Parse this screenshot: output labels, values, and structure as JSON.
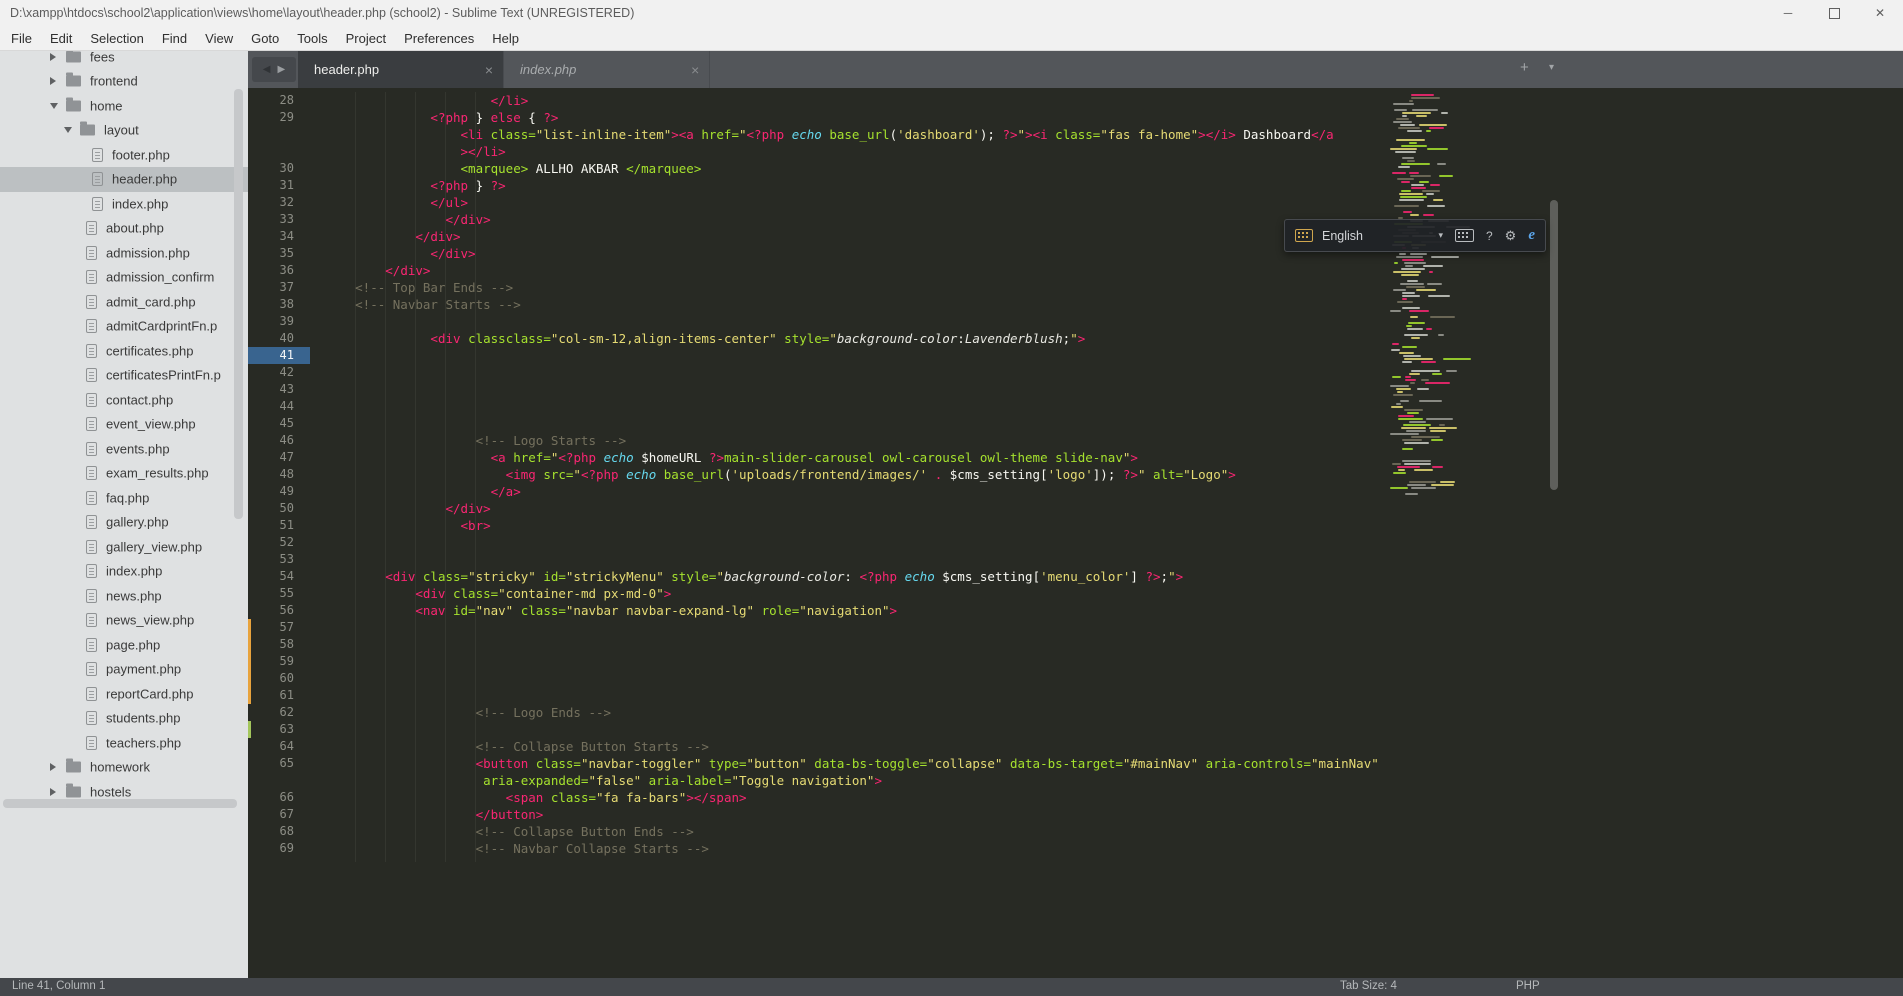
{
  "window": {
    "title": "D:\\xampp\\htdocs\\school2\\application\\views\\home\\layout\\header.php (school2) - Sublime Text (UNREGISTERED)",
    "controls": {
      "minimize": "─",
      "close": "✕"
    }
  },
  "menu": {
    "items": [
      "File",
      "Edit",
      "Selection",
      "Find",
      "View",
      "Goto",
      "Tools",
      "Project",
      "Preferences",
      "Help"
    ]
  },
  "sidebar": {
    "items": [
      {
        "label": "fees",
        "kind": "folder",
        "depth": "1",
        "arrow": "right"
      },
      {
        "label": "frontend",
        "kind": "folder",
        "depth": "1",
        "arrow": "right"
      },
      {
        "label": "home",
        "kind": "folder",
        "depth": "1",
        "arrow": "down"
      },
      {
        "label": "layout",
        "kind": "folder",
        "depth": "2",
        "arrow": "down"
      },
      {
        "label": "footer.php",
        "kind": "file",
        "depth": "3"
      },
      {
        "label": "header.php",
        "kind": "file",
        "depth": "3",
        "selected": true
      },
      {
        "label": "index.php",
        "kind": "file",
        "depth": "3"
      },
      {
        "label": "about.php",
        "kind": "file",
        "depth": "2f"
      },
      {
        "label": "admission.php",
        "kind": "file",
        "depth": "2f"
      },
      {
        "label": "admission_confirm",
        "kind": "file",
        "depth": "2f"
      },
      {
        "label": "admit_card.php",
        "kind": "file",
        "depth": "2f"
      },
      {
        "label": "admitCardprintFn.p",
        "kind": "file",
        "depth": "2f"
      },
      {
        "label": "certificates.php",
        "kind": "file",
        "depth": "2f"
      },
      {
        "label": "certificatesPrintFn.p",
        "kind": "file",
        "depth": "2f"
      },
      {
        "label": "contact.php",
        "kind": "file",
        "depth": "2f"
      },
      {
        "label": "event_view.php",
        "kind": "file",
        "depth": "2f"
      },
      {
        "label": "events.php",
        "kind": "file",
        "depth": "2f"
      },
      {
        "label": "exam_results.php",
        "kind": "file",
        "depth": "2f"
      },
      {
        "label": "faq.php",
        "kind": "file",
        "depth": "2f"
      },
      {
        "label": "gallery.php",
        "kind": "file",
        "depth": "2f"
      },
      {
        "label": "gallery_view.php",
        "kind": "file",
        "depth": "2f"
      },
      {
        "label": "index.php",
        "kind": "file",
        "depth": "2f"
      },
      {
        "label": "news.php",
        "kind": "file",
        "depth": "2f"
      },
      {
        "label": "news_view.php",
        "kind": "file",
        "depth": "2f"
      },
      {
        "label": "page.php",
        "kind": "file",
        "depth": "2f"
      },
      {
        "label": "payment.php",
        "kind": "file",
        "depth": "2f"
      },
      {
        "label": "reportCard.php",
        "kind": "file",
        "depth": "2f"
      },
      {
        "label": "students.php",
        "kind": "file",
        "depth": "2f"
      },
      {
        "label": "teachers.php",
        "kind": "file",
        "depth": "2f"
      },
      {
        "label": "homework",
        "kind": "folder",
        "depth": "1",
        "arrow": "right"
      },
      {
        "label": "hostels",
        "kind": "folder",
        "depth": "1",
        "arrow": "right"
      }
    ]
  },
  "tabs": {
    "list": [
      {
        "label": "header.php",
        "active": true
      },
      {
        "label": "index.php",
        "active": false
      }
    ],
    "close_glyph": "×",
    "new_tab_glyph": "+",
    "overflow_glyph": "▾",
    "back_glyph": "◀",
    "forward_glyph": "▶"
  },
  "editor": {
    "rows": [
      {
        "n": "28",
        "s": [
          [
            "w",
            "                        "
          ],
          [
            "r",
            "</li>"
          ]
        ]
      },
      {
        "n": "29",
        "s": [
          [
            "w",
            "                "
          ],
          [
            "r",
            "<?php"
          ],
          [
            "w",
            " } "
          ],
          [
            "r",
            "else"
          ],
          [
            "w",
            " { "
          ],
          [
            "r",
            "?>"
          ]
        ]
      },
      {
        "n": "",
        "s": [
          [
            "w",
            "                    "
          ],
          [
            "r",
            "<li"
          ],
          [
            "w",
            " "
          ],
          [
            "g",
            "class="
          ],
          [
            "y",
            "\"list-inline-item\""
          ],
          [
            "r",
            "><a"
          ],
          [
            "w",
            " "
          ],
          [
            "g",
            "href="
          ],
          [
            "y",
            "\""
          ],
          [
            "r",
            "<?php"
          ],
          [
            "w",
            " "
          ],
          [
            "b",
            "echo"
          ],
          [
            "w",
            " "
          ],
          [
            "g",
            "base_url"
          ],
          [
            "w",
            "("
          ],
          [
            "y",
            "'dashboard'"
          ],
          [
            "w",
            "); "
          ],
          [
            "r",
            "?>"
          ],
          [
            "y",
            "\""
          ],
          [
            "r",
            "><i"
          ],
          [
            "w",
            " "
          ],
          [
            "g",
            "class="
          ],
          [
            "y",
            "\"fas fa-home\""
          ],
          [
            "r",
            "></i>"
          ],
          [
            "w",
            " Dashboard"
          ],
          [
            "r",
            "</a"
          ]
        ]
      },
      {
        "n": "",
        "s": [
          [
            "w",
            "                    "
          ],
          [
            "r",
            "></li>"
          ]
        ]
      },
      {
        "n": "30",
        "s": [
          [
            "w",
            "                    "
          ],
          [
            "g",
            "<marquee>"
          ],
          [
            "w",
            " ALLHO AKBAR "
          ],
          [
            "g",
            "</marquee>"
          ]
        ]
      },
      {
        "n": "31",
        "s": [
          [
            "w",
            "                "
          ],
          [
            "r",
            "<?php"
          ],
          [
            "w",
            " } "
          ],
          [
            "r",
            "?>"
          ]
        ]
      },
      {
        "n": "32",
        "s": [
          [
            "w",
            "                "
          ],
          [
            "r",
            "</ul>"
          ]
        ]
      },
      {
        "n": "33",
        "s": [
          [
            "w",
            "                  "
          ],
          [
            "r",
            "</div>"
          ]
        ]
      },
      {
        "n": "34",
        "s": [
          [
            "w",
            "              "
          ],
          [
            "r",
            "</div>"
          ]
        ]
      },
      {
        "n": "35",
        "s": [
          [
            "w",
            "                "
          ],
          [
            "r",
            "</div>"
          ]
        ]
      },
      {
        "n": "36",
        "s": [
          [
            "w",
            "          "
          ],
          [
            "r",
            "</div>"
          ]
        ]
      },
      {
        "n": "37",
        "s": [
          [
            "w",
            "      "
          ],
          [
            "c",
            "<!-- Top Bar Ends -->"
          ]
        ]
      },
      {
        "n": "38",
        "s": [
          [
            "w",
            "      "
          ],
          [
            "c",
            "<!-- Navbar Starts -->"
          ]
        ]
      },
      {
        "n": "39",
        "s": []
      },
      {
        "n": "40",
        "s": [
          [
            "w",
            "                "
          ],
          [
            "r",
            "<div"
          ],
          [
            "w",
            " "
          ],
          [
            "g",
            "classclass="
          ],
          [
            "y",
            "\"col-sm-12,align-items-center\""
          ],
          [
            "w",
            " "
          ],
          [
            "g",
            "style="
          ],
          [
            "y",
            "\""
          ],
          [
            "ci",
            "background-color"
          ],
          [
            "w",
            ":"
          ],
          [
            "ci",
            "Lavenderblush"
          ],
          [
            "w",
            ";"
          ],
          [
            "y",
            "\""
          ],
          [
            "r",
            ">"
          ]
        ]
      },
      {
        "n": "41",
        "hl": true,
        "s": []
      },
      {
        "n": "42",
        "s": []
      },
      {
        "n": "43",
        "s": []
      },
      {
        "n": "44",
        "s": []
      },
      {
        "n": "45",
        "s": []
      },
      {
        "n": "46",
        "s": [
          [
            "w",
            "                      "
          ],
          [
            "c",
            "<!-- Logo Starts -->"
          ]
        ]
      },
      {
        "n": "47",
        "s": [
          [
            "w",
            "                        "
          ],
          [
            "r",
            "<a"
          ],
          [
            "w",
            " "
          ],
          [
            "g",
            "href="
          ],
          [
            "y",
            "\""
          ],
          [
            "r",
            "<?php"
          ],
          [
            "w",
            " "
          ],
          [
            "b",
            "echo"
          ],
          [
            "w",
            " $homeURL "
          ],
          [
            "r",
            "?>"
          ],
          [
            "g",
            "main-slider-carousel owl-carousel owl-theme slide-nav"
          ],
          [
            "y",
            "\""
          ],
          [
            "r",
            ">"
          ]
        ]
      },
      {
        "n": "48",
        "s": [
          [
            "w",
            "                          "
          ],
          [
            "r",
            "<img"
          ],
          [
            "w",
            " "
          ],
          [
            "g",
            "src="
          ],
          [
            "y",
            "\""
          ],
          [
            "r",
            "<?php"
          ],
          [
            "w",
            " "
          ],
          [
            "b",
            "echo"
          ],
          [
            "w",
            " "
          ],
          [
            "g",
            "base_url"
          ],
          [
            "w",
            "("
          ],
          [
            "y",
            "'uploads/frontend/images/'"
          ],
          [
            "w",
            " "
          ],
          [
            "r",
            "."
          ],
          [
            "w",
            " $cms_setting["
          ],
          [
            "y",
            "'logo'"
          ],
          [
            "w",
            "]); "
          ],
          [
            "r",
            "?>"
          ],
          [
            "y",
            "\""
          ],
          [
            "w",
            " "
          ],
          [
            "g",
            "alt="
          ],
          [
            "y",
            "\"Logo\""
          ],
          [
            "r",
            ">"
          ]
        ]
      },
      {
        "n": "49",
        "s": [
          [
            "w",
            "                        "
          ],
          [
            "r",
            "</a>"
          ]
        ]
      },
      {
        "n": "50",
        "s": [
          [
            "w",
            "                  "
          ],
          [
            "r",
            "</div>"
          ]
        ]
      },
      {
        "n": "51",
        "s": [
          [
            "w",
            "                    "
          ],
          [
            "r",
            "<br>"
          ]
        ]
      },
      {
        "n": "52",
        "s": []
      },
      {
        "n": "53",
        "s": []
      },
      {
        "n": "54",
        "s": [
          [
            "w",
            "          "
          ],
          [
            "r",
            "<div"
          ],
          [
            "w",
            " "
          ],
          [
            "g",
            "class="
          ],
          [
            "y",
            "\"stricky\""
          ],
          [
            "w",
            " "
          ],
          [
            "g",
            "id="
          ],
          [
            "y",
            "\"strickyMenu\""
          ],
          [
            "w",
            " "
          ],
          [
            "g",
            "style="
          ],
          [
            "y",
            "\""
          ],
          [
            "ci",
            "background-color"
          ],
          [
            "w",
            ": "
          ],
          [
            "r",
            "<?php"
          ],
          [
            "w",
            " "
          ],
          [
            "b",
            "echo"
          ],
          [
            "w",
            " $cms_setting["
          ],
          [
            "y",
            "'menu_color'"
          ],
          [
            "w",
            "] "
          ],
          [
            "r",
            "?>"
          ],
          [
            "w",
            ";"
          ],
          [
            "y",
            "\""
          ],
          [
            "r",
            ">"
          ]
        ]
      },
      {
        "n": "55",
        "s": [
          [
            "w",
            "              "
          ],
          [
            "r",
            "<div"
          ],
          [
            "w",
            " "
          ],
          [
            "g",
            "class="
          ],
          [
            "y",
            "\"container-md px-md-0\""
          ],
          [
            "r",
            ">"
          ]
        ]
      },
      {
        "n": "56",
        "s": [
          [
            "w",
            "              "
          ],
          [
            "r",
            "<nav"
          ],
          [
            "w",
            " "
          ],
          [
            "g",
            "id="
          ],
          [
            "y",
            "\"nav\""
          ],
          [
            "w",
            " "
          ],
          [
            "g",
            "class="
          ],
          [
            "y",
            "\"navbar navbar-expand-lg\""
          ],
          [
            "w",
            " "
          ],
          [
            "g",
            "role="
          ],
          [
            "y",
            "\"navigation\""
          ],
          [
            "r",
            ">"
          ]
        ]
      },
      {
        "n": "57",
        "s": []
      },
      {
        "n": "58",
        "s": []
      },
      {
        "n": "59",
        "s": []
      },
      {
        "n": "60",
        "s": []
      },
      {
        "n": "61",
        "s": []
      },
      {
        "n": "62",
        "s": [
          [
            "w",
            "                      "
          ],
          [
            "c",
            "<!-- Logo Ends -->"
          ]
        ]
      },
      {
        "n": "63",
        "s": []
      },
      {
        "n": "64",
        "s": [
          [
            "w",
            "                      "
          ],
          [
            "c",
            "<!-- Collapse Button Starts -->"
          ]
        ]
      },
      {
        "n": "65",
        "s": [
          [
            "w",
            "                      "
          ],
          [
            "r",
            "<button"
          ],
          [
            "w",
            " "
          ],
          [
            "g",
            "class="
          ],
          [
            "y",
            "\"navbar-toggler\""
          ],
          [
            "w",
            " "
          ],
          [
            "g",
            "type="
          ],
          [
            "y",
            "\"button\""
          ],
          [
            "w",
            " "
          ],
          [
            "g",
            "data-bs-toggle="
          ],
          [
            "y",
            "\"collapse\""
          ],
          [
            "w",
            " "
          ],
          [
            "g",
            "data-bs-target="
          ],
          [
            "y",
            "\"#mainNav\""
          ],
          [
            "w",
            " "
          ],
          [
            "g",
            "aria-controls="
          ],
          [
            "y",
            "\"mainNav\""
          ]
        ]
      },
      {
        "n": "",
        "s": [
          [
            "w",
            "                       "
          ],
          [
            "g",
            "aria-expanded="
          ],
          [
            "y",
            "\"false\""
          ],
          [
            "w",
            " "
          ],
          [
            "g",
            "aria-label="
          ],
          [
            "y",
            "\"Toggle navigation\""
          ],
          [
            "r",
            ">"
          ]
        ]
      },
      {
        "n": "66",
        "s": [
          [
            "w",
            "                          "
          ],
          [
            "r",
            "<span"
          ],
          [
            "w",
            " "
          ],
          [
            "g",
            "class="
          ],
          [
            "y",
            "\"fa fa-bars\""
          ],
          [
            "r",
            "></span>"
          ]
        ]
      },
      {
        "n": "67",
        "s": [
          [
            "w",
            "                      "
          ],
          [
            "r",
            "</button>"
          ]
        ]
      },
      {
        "n": "68",
        "s": [
          [
            "w",
            "                      "
          ],
          [
            "c",
            "<!-- Collapse Button Ends -->"
          ]
        ]
      },
      {
        "n": "69",
        "s": [
          [
            "w",
            "                      "
          ],
          [
            "c",
            "<!-- Navbar Collapse Starts -->"
          ]
        ]
      }
    ],
    "markers": {
      "orange": [
        "57",
        "58",
        "59",
        "60",
        "61"
      ],
      "green": [
        "63"
      ]
    }
  },
  "language_bar": {
    "label": "English",
    "chevron_glyph": "▾",
    "help_glyph": "?",
    "gear_glyph": "⚙",
    "ie_glyph": "e"
  },
  "status_bar": {
    "position": "Line 41, Column 1",
    "tab_size": "Tab Size: 4",
    "syntax": "PHP"
  }
}
